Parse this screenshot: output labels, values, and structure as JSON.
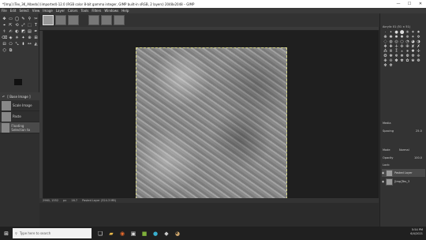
{
  "window": {
    "title": "*[Imp] (Tex_3K_Albedo] (imported)-12.0 (RGB color 8-bit gamma integer, GIMP built-in sRGB, 2 layers) 2048x2048 – GIMP",
    "minimize": "—",
    "maximize": "☐",
    "close": "✕"
  },
  "menu": [
    "File",
    "Edit",
    "Select",
    "View",
    "Image",
    "Layer",
    "Colors",
    "Tools",
    "Filters",
    "Windows",
    "Help"
  ],
  "tools": [
    "✥",
    "▭",
    "◯",
    "✎",
    "⚲",
    "✂",
    "⌖",
    "⇱",
    "⟲",
    "⤢",
    "⬚",
    "T",
    "⚕",
    "✍",
    "◐",
    "◩",
    "▤",
    "✒",
    "⌫",
    "◈",
    "☀",
    "✦",
    "⊕",
    "⊞",
    "⊟",
    "⎔",
    "⤡",
    "⬍",
    "⚯",
    "◭",
    "⬡",
    "⧉"
  ],
  "undo": {
    "header": "[ Base Image ]",
    "items": [
      "Scale Image",
      "Paste",
      "Floating Selection to"
    ]
  },
  "statusbar": {
    "coords": "2960, 1552",
    "unit": "px",
    "zoom": "16.7",
    "info": "Pasted Layer (324.3 MB)"
  },
  "right": {
    "brush_title": "Acrylic 01 (51 × 51)",
    "brush_glyphs": [
      "·",
      "•",
      "●",
      "⬤",
      "✳",
      "✶",
      "✷",
      "❋",
      "✺",
      "✹",
      "✸",
      "✵",
      "✴",
      "✲",
      "◌",
      "◍",
      "◎",
      "○",
      "◔",
      "◕",
      "◑",
      "❖",
      "✚",
      "✛",
      "✜",
      "✙",
      "✘",
      "✗",
      "⁂",
      "※",
      "⁑",
      "⁎",
      "∗",
      "✱",
      "✢",
      "❂",
      "❃",
      "❄",
      "❅",
      "❆",
      "❇",
      "❈",
      "❉",
      "❊",
      "✽",
      "✾",
      "✿",
      "❀",
      "❁",
      "✻",
      "✼"
    ],
    "filter_label": "Media",
    "spacing_label": "Spacing",
    "spacing_value": "25.0",
    "mode_label": "Mode",
    "mode_value": "Normal",
    "opacity_label": "Opacity",
    "opacity_value": "100.0",
    "lock_label": "Lock:",
    "layers": [
      "Pasted Layer",
      "[Imp]Tex_3"
    ]
  },
  "taskbar": {
    "search_placeholder": "Type here to search",
    "time": "5:54 PM",
    "date": "6/4/2021"
  },
  "colors": {
    "fg": "#111111",
    "bg": "#6a7a20"
  }
}
